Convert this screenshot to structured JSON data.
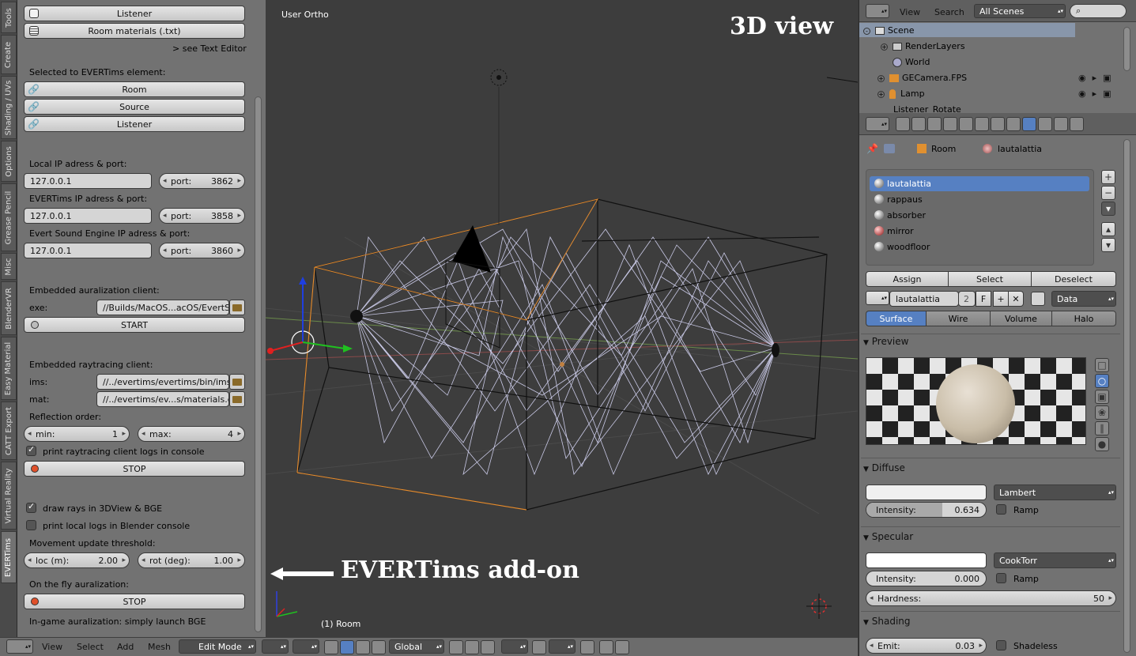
{
  "sidebar_tabs": [
    "Tools",
    "Create",
    "Shading / UVs",
    "Options",
    "Grease Pencil",
    "Misc",
    "BlenderVR",
    "Easy Material",
    "CATT Export",
    "Virtual Reality",
    "EVERTims"
  ],
  "tools": {
    "listener_btn": "Listener",
    "room_materials_btn": "Room materials (.txt)",
    "see_text_editor": "> see Text Editor",
    "selected_label": "Selected to EVERTims element:",
    "room_btn": "Room",
    "source_btn": "Source",
    "listener2_btn": "Listener",
    "local_ip_label": "Local IP adress & port:",
    "local_ip": "127.0.0.1",
    "local_port_label": "port:",
    "local_port": "3862",
    "evertims_ip_label": "EVERTims IP adress & port:",
    "evertims_ip": "127.0.0.1",
    "evertims_port_label": "port:",
    "evertims_port": "3858",
    "engine_ip_label": "Evert Sound Engine IP adress & port:",
    "engine_ip": "127.0.0.1",
    "engine_port_label": "port:",
    "engine_port": "3860",
    "auralization_label": "Embedded auralization client:",
    "exe_label": "exe:",
    "exe_value": "//Builds/MacOS...acOS/EvertSE",
    "start_btn": "START",
    "raytracing_label": "Embedded raytracing client:",
    "ims_label": "ims:",
    "ims_value": "//../evertims/evertims/bin/ims",
    "mat_label": "mat:",
    "mat_value": "//../evertims/ev...s/materials.dat",
    "reflection_label": "Reflection order:",
    "min_label": "min:",
    "min_value": "1",
    "max_label": "max:",
    "max_value": "4",
    "print_rt_logs": "print raytracing client logs in console",
    "stop_btn_1": "STOP",
    "draw_rays": "draw rays in 3DView & BGE",
    "print_local_logs": "print local logs in Blender console",
    "movement_label": "Movement update threshold:",
    "loc_label": "loc (m):",
    "loc_value": "2.00",
    "rot_label": "rot (deg):",
    "rot_value": "1.00",
    "fly_label": "On the fly auralization:",
    "stop_btn_2": "STOP",
    "ingame_label": "In-game auralization: simply launch BGE"
  },
  "viewport": {
    "view_name": "User Ortho",
    "object_label": "(1) Room",
    "annotation_top": "3D view",
    "annotation_bottom": "EVERTims add-on"
  },
  "bottom_bar": {
    "view": "View",
    "select": "Select",
    "add": "Add",
    "mesh": "Mesh",
    "mode": "Edit Mode",
    "orientation": "Global"
  },
  "outliner": {
    "view": "View",
    "search": "Search",
    "scenes_dropdown": "All Scenes",
    "items": [
      "Scene",
      "RenderLayers",
      "World",
      "GECamera.FPS",
      "Lamp",
      "Listener_Rotate"
    ]
  },
  "properties": {
    "breadcrumb_object": "Room",
    "breadcrumb_material": "lautalattia",
    "materials": [
      "lautalattia",
      "rappaus",
      "absorber",
      "mirror",
      "woodfloor"
    ],
    "selected_material_index": 0,
    "assign": "Assign",
    "select": "Select",
    "deselect": "Deselect",
    "material_name": "lautalattia",
    "users_count": "2",
    "fake_user": "F",
    "link_dropdown": "Data",
    "tabs": [
      "Surface",
      "Wire",
      "Volume",
      "Halo"
    ],
    "active_tab": "Surface",
    "preview_title": "Preview",
    "diffuse_title": "Diffuse",
    "diffuse_shader": "Lambert",
    "diffuse_intensity_label": "Intensity:",
    "diffuse_intensity": "0.634",
    "ramp": "Ramp",
    "specular_title": "Specular",
    "specular_shader": "CookTorr",
    "specular_intensity_label": "Intensity:",
    "specular_intensity": "0.000",
    "hardness_label": "Hardness:",
    "hardness": "50",
    "shading_title": "Shading",
    "emit_label": "Emit:",
    "emit": "0.03",
    "shadeless": "Shadeless"
  },
  "colors": {
    "selection_blue": "#5680c2",
    "panel_gray": "#727272",
    "viewport_gray": "#3d3d3d",
    "ray_color": "#c9c9e6"
  }
}
